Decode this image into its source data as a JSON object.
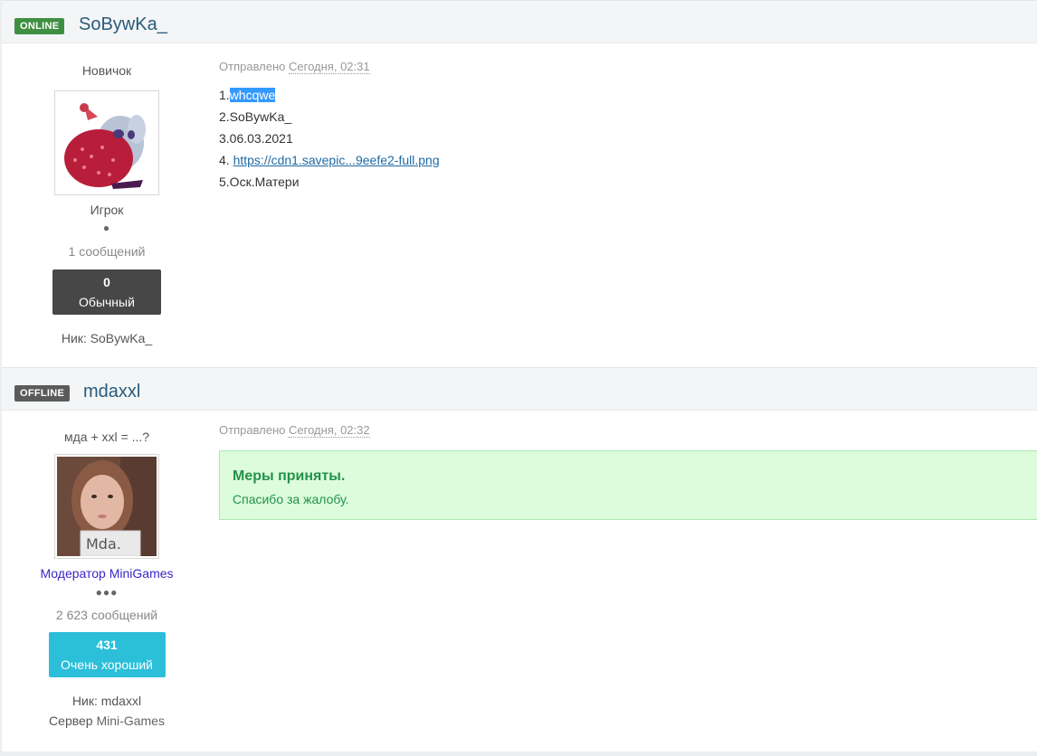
{
  "posts": [
    {
      "status": "ONLINE",
      "username": "SoBywKa_",
      "title": "Новичок",
      "group": "Игрок",
      "pips": "●",
      "message_count": "1 сообщений",
      "reputation": {
        "value": "0",
        "label": "Обычный",
        "color": "#474747"
      },
      "fields": [
        {
          "label": "Ник: ",
          "value": "SoBywKa_"
        }
      ],
      "posted_label": "Отправлено",
      "posted_date": "Сегодня, 02:31",
      "lines": {
        "l1_prefix": "1.",
        "l1_highlight": "whcqwe",
        "l2": "2.SoBywKa_",
        "l3": "3.06.03.2021",
        "l4_prefix": "4. ",
        "l4_link": "https://cdn1.savepic...9eefe2-full.png",
        "l5": "5.Оск.Матери"
      }
    },
    {
      "status": "OFFLINE",
      "username": "mdaxxl",
      "title": "мда + xxl = ...?",
      "group_prefix": "Модератор ",
      "group_suffix": "MiniGames",
      "pips": "●●●",
      "message_count": "2 623 сообщений",
      "reputation": {
        "value": "431",
        "label": "Очень хороший",
        "color": "#2bbfda"
      },
      "fields": [
        {
          "label": "Ник: ",
          "value": "mdaxxl"
        },
        {
          "label": "Сервер ",
          "value": "Mini-Games"
        }
      ],
      "posted_label": "Отправлено",
      "posted_date": "Сегодня, 02:32",
      "notice": {
        "heading": "Меры приняты.",
        "text": "Спасибо за жалобу."
      },
      "avatar_caption": "Mda."
    }
  ]
}
